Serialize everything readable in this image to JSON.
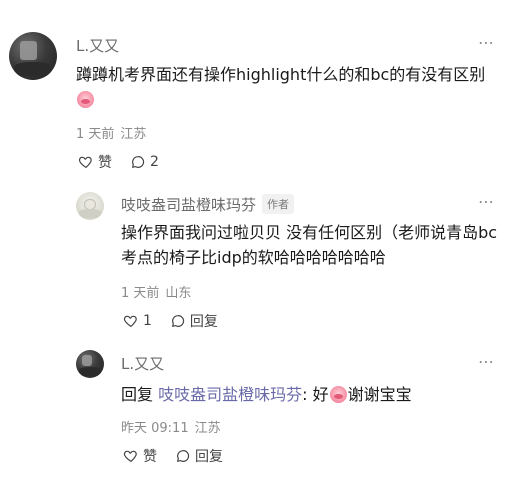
{
  "comment1": {
    "author": "L.又又",
    "text": "蹲蹲机考界面还有操作highlight什么的和bc的有没有区别",
    "time": "1 天前",
    "location": "江苏",
    "like_label": "赞",
    "reply_count": "2",
    "more": "⋯"
  },
  "reply1": {
    "author": "吱吱盎司盐橙味玛芬",
    "badge": "作者",
    "text": "操作界面我问过啦贝贝 没有任何区别（老师说青岛bc考点的椅子比idp的软哈哈哈哈哈哈哈",
    "time": "1 天前",
    "location": "山东",
    "like_count": "1",
    "reply_label": "回复",
    "more": "⋯"
  },
  "reply2": {
    "author": "L.又又",
    "prefix": "回复",
    "target": "吱吱盎司盐橙味玛芬",
    "separator": ": ",
    "text_before": "好",
    "text_after": "谢谢宝宝",
    "time": "昨天 09:11",
    "location": "江苏",
    "like_label": "赞",
    "reply_label": "回复",
    "more": "⋯"
  },
  "icons": [
    "heart-icon",
    "comment-icon",
    "more-icon",
    "emoji-icon"
  ],
  "colors": {
    "text": "#1a1a1a",
    "secondary": "#8a8a8a",
    "name": "#6b6b6b",
    "link": "#6a6aa8"
  }
}
